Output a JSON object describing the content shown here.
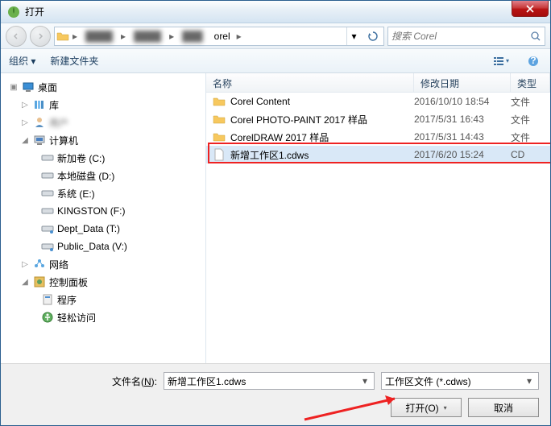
{
  "window": {
    "title": "打开"
  },
  "addressbar": {
    "crumb_last": "orel",
    "search_placeholder": "搜索 Corel"
  },
  "toolbar": {
    "organize": "组织 ▾",
    "new_folder": "新建文件夹"
  },
  "tree": {
    "desktop": "桌面",
    "libraries": "库",
    "user_blur": "用户",
    "computer": "计算机",
    "drive_c": "新加卷 (C:)",
    "drive_d": "本地磁盘 (D:)",
    "drive_e": "系统 (E:)",
    "drive_f": "KINGSTON (F:)",
    "drive_t": "Dept_Data (T:)",
    "drive_v": "Public_Data (V:)",
    "network": "网络",
    "control_panel": "控制面板",
    "programs": "程序",
    "ease_access": "轻松访问"
  },
  "columns": {
    "name": "名称",
    "date": "修改日期",
    "type": "类型"
  },
  "files": [
    {
      "name": "Corel Content",
      "date": "2016/10/10 18:54",
      "type": "文件",
      "kind": "folder"
    },
    {
      "name": "Corel PHOTO-PAINT 2017 样品",
      "date": "2017/5/31 16:43",
      "type": "文件",
      "kind": "folder"
    },
    {
      "name": "CorelDRAW 2017 样品",
      "date": "2017/5/31 14:43",
      "type": "文件",
      "kind": "folder"
    },
    {
      "name": "新增工作区1.cdws",
      "date": "2017/6/20 15:24",
      "type": "CD",
      "kind": "file",
      "selected": true
    }
  ],
  "footer": {
    "filename_label_pre": "文件名(",
    "filename_label_key": "N",
    "filename_label_post": "):",
    "filename_value": "新增工作区1.cdws",
    "filter_value": "工作区文件 (*.cdws)",
    "open_label": "打开(O)",
    "cancel_label": "取消"
  }
}
